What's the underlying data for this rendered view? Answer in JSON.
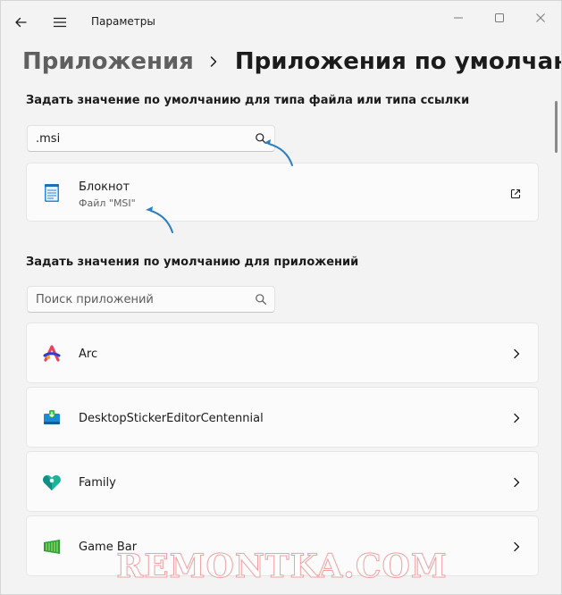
{
  "window": {
    "app_title": "Параметры"
  },
  "breadcrumb": {
    "parent": "Приложения",
    "current": "Приложения по умолчанию"
  },
  "file_type_section": {
    "label": "Задать значение по умолчанию для типа файла или типа ссылки",
    "search_value": ".msi",
    "result": {
      "name": "Блокнот",
      "subtitle": "Файл \"MSI\"",
      "icon": "notepad-icon",
      "action_icon": "open-external-icon"
    }
  },
  "apps_section": {
    "label": "Задать значения по умолчанию для приложений",
    "search_placeholder": "Поиск приложений",
    "apps": [
      {
        "name": "Arc",
        "icon": "arc-icon"
      },
      {
        "name": "DesktopStickerEditorCentennial",
        "icon": "sticker-editor-icon"
      },
      {
        "name": "Family",
        "icon": "family-icon"
      },
      {
        "name": "Game Bar",
        "icon": "game-bar-icon"
      }
    ]
  },
  "watermark": "REMONTKA.COM",
  "colors": {
    "background": "#f3f3f3",
    "card": "#fbfbfb",
    "annotation_arrow": "#2b7fc3"
  }
}
